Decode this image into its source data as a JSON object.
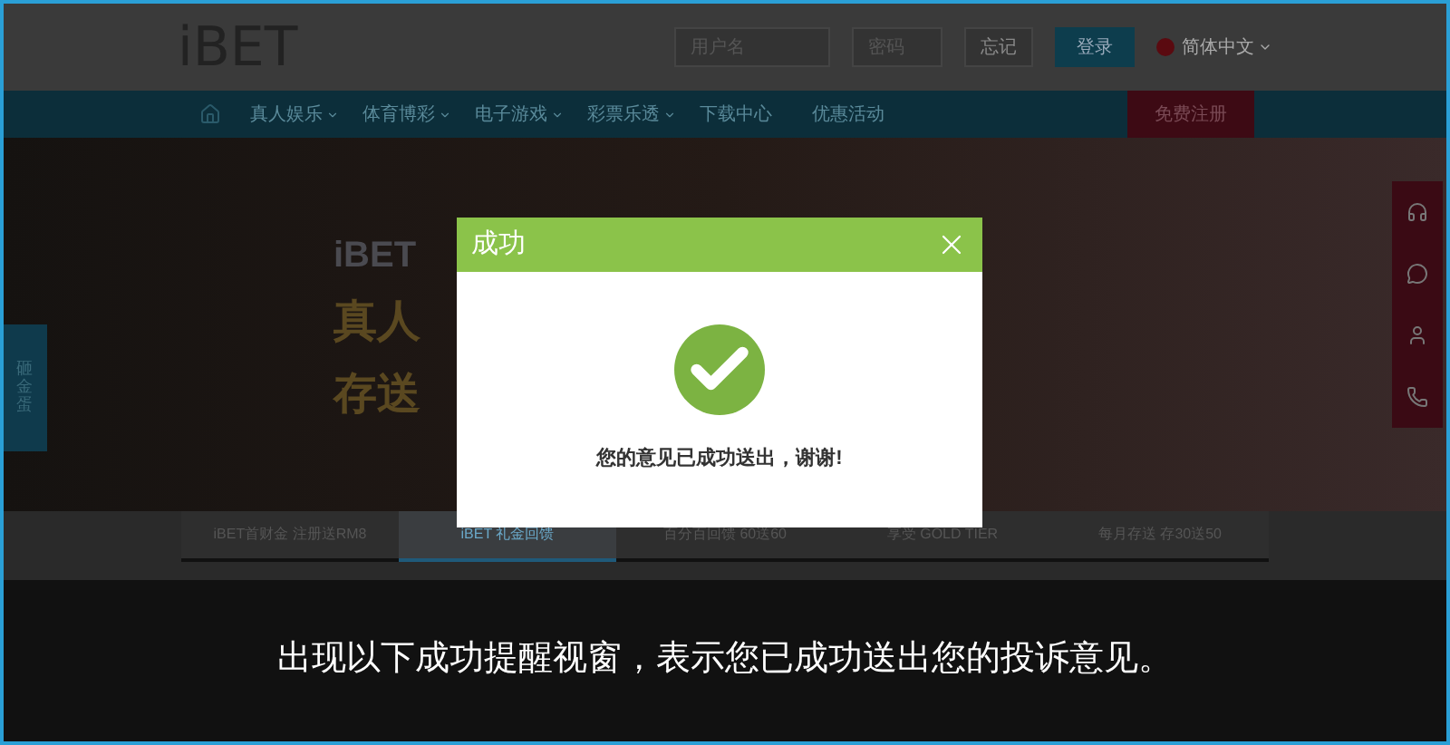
{
  "header": {
    "logo": "iBET",
    "username": {
      "placeholder": "用户名"
    },
    "password": {
      "placeholder": "密码"
    },
    "forgot": "忘记",
    "login": "登录",
    "language": "简体中文"
  },
  "nav": {
    "items": [
      {
        "label": "真人娱乐",
        "dropdown": true
      },
      {
        "label": "体育博彩",
        "dropdown": true
      },
      {
        "label": "电子游戏",
        "dropdown": true
      },
      {
        "label": "彩票乐透",
        "dropdown": true
      },
      {
        "label": "下载中心",
        "dropdown": false
      },
      {
        "label": "优惠活动",
        "dropdown": false
      }
    ],
    "register": "免费注册"
  },
  "banner": {
    "lines": [
      "iBET",
      "真人",
      "存送"
    ],
    "side_tab": "砸金蛋"
  },
  "promo_tabs": [
    {
      "label": "iBET首财金 注册送RM8",
      "selected": false
    },
    {
      "label": "iBET 礼金回馈",
      "selected": true
    },
    {
      "label": "百分百回馈 60送60",
      "selected": false
    },
    {
      "label": "享受 GOLD TIER",
      "selected": false
    },
    {
      "label": "每月存送 存30送50",
      "selected": false
    }
  ],
  "modal": {
    "title": "成功",
    "message": "您的意见已成功送出，谢谢!"
  },
  "caption": "出现以下成功提醒视窗，表示您已成功送出您的投诉意见。"
}
